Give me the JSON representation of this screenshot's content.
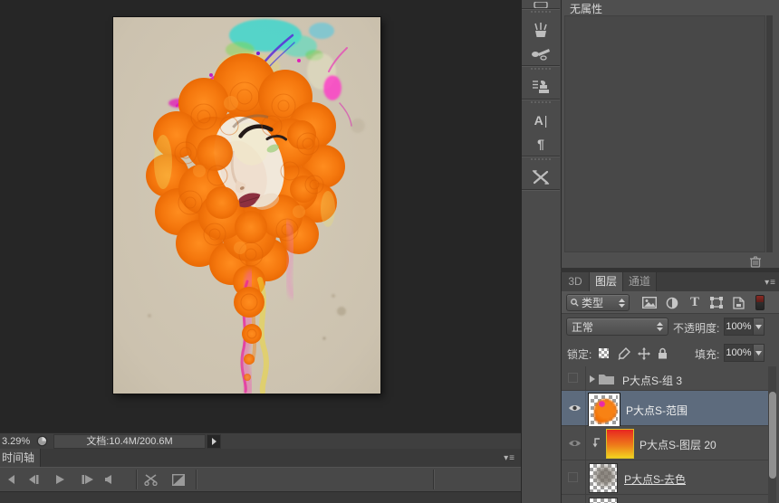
{
  "properties_panel": {
    "title": "无属性"
  },
  "tool_dock": {
    "icons": [
      "brush-panel",
      "brush-presets",
      "clone-source",
      "character",
      "paragraph",
      "tool-presets"
    ],
    "character_glyph": "A",
    "paragraph_glyph": "¶"
  },
  "layers_panel": {
    "tab_3d": "3D",
    "tab_layers": "图层",
    "tab_channels": "通道",
    "filter_kind": "类型",
    "blend_mode": "正常",
    "opacity_label": "不透明度:",
    "opacity_value": "100%",
    "lock_label": "锁定:",
    "fill_label": "填充:",
    "fill_value": "100%",
    "layers": [
      {
        "name": "P大点S-组 3"
      },
      {
        "name": "P大点S-范围"
      },
      {
        "name": "P大点S-图层 20"
      },
      {
        "name": "P大点S-去色"
      }
    ]
  },
  "status_bar": {
    "zoom_level": "3.29%",
    "doc_info": "文档:10.4M/200.6M"
  },
  "timeline": {
    "tab_label": "时间轴"
  },
  "colors": {
    "selected_layer_row": "#5d6b7d",
    "artwork_orange": "#f5780e",
    "panel_background": "#4c4c4c",
    "canvas_background": "#262626"
  }
}
